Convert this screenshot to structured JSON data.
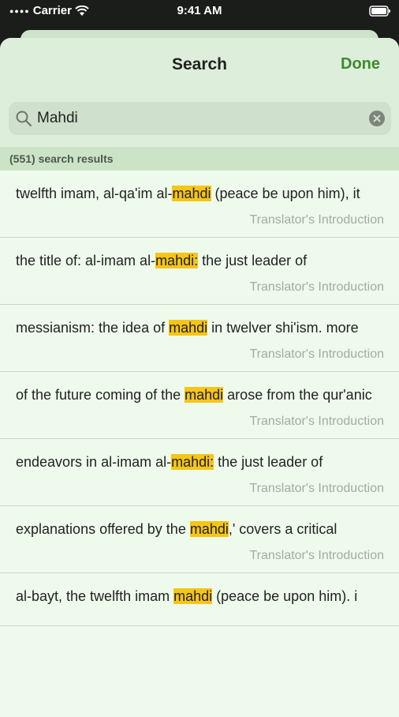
{
  "status_bar": {
    "carrier": "Carrier",
    "time": "9:41 AM"
  },
  "nav": {
    "title": "Search",
    "done_label": "Done"
  },
  "search": {
    "value": "Mahdi"
  },
  "results_count": "(551) search results",
  "results": [
    {
      "before": "twelfth imam, al-qa'im al-",
      "match": "mahdi",
      "after": " (peace be upon him), it",
      "source": "Translator's Introduction"
    },
    {
      "before": "the title of: al-imam al-",
      "match": "mahdi:",
      "after": " the just leader of",
      "source": "Translator's Introduction"
    },
    {
      "before": "messianism: the idea of ",
      "match": "mahdi",
      "after": " in twelver shi'ism. more",
      "source": "Translator's Introduction"
    },
    {
      "before": "of the future coming of the ",
      "match": "mahdi",
      "after": " arose from the qur'anic",
      "source": "Translator's Introduction"
    },
    {
      "before": "endeavors in al-imam al-",
      "match": "mahdi:",
      "after": " the just leader of",
      "source": "Translator's Introduction"
    },
    {
      "before": "explanations offered by the ",
      "match": "mahdi",
      "after": ",' covers a critical",
      "source": "Translator's Introduction"
    },
    {
      "before": "al-bayt, the twelfth imam ",
      "match": "mahdi",
      "after": " (peace be upon him). i",
      "source": ""
    }
  ],
  "colors": {
    "accent": "#3e8a2f",
    "highlight": "#f5c518"
  }
}
